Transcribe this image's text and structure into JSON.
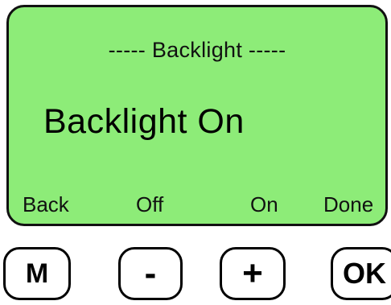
{
  "screen": {
    "header": "----- Backlight -----",
    "value": "Backlight On",
    "softkeys": [
      "Back",
      "Off",
      "On",
      "Done"
    ],
    "background_color": "#8dec78"
  },
  "buttons": {
    "menu": "M",
    "minus": "-",
    "plus": "+",
    "ok": "OK"
  }
}
